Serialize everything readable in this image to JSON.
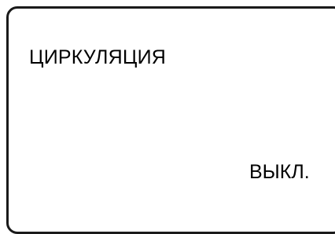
{
  "display": {
    "title": "ЦИРКУЛЯЦИЯ",
    "value": "ВЫКЛ."
  }
}
